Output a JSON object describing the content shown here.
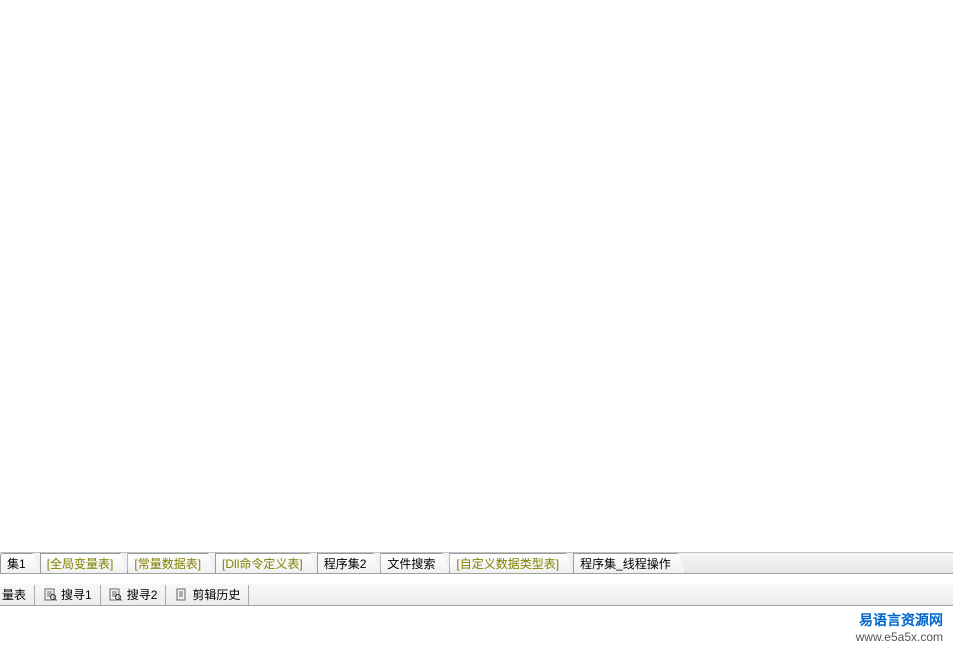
{
  "tabs": [
    {
      "label": "集1",
      "highlighted": false
    },
    {
      "label": "[全局变量表]",
      "highlighted": true
    },
    {
      "label": "[常量数据表]",
      "highlighted": true
    },
    {
      "label": "[Dll命令定义表]",
      "highlighted": true
    },
    {
      "label": "程序集2",
      "highlighted": false
    },
    {
      "label": "文件搜索",
      "highlighted": false
    },
    {
      "label": "[自定义数据类型表]",
      "highlighted": true
    },
    {
      "label": "程序集_线程操作",
      "highlighted": false
    }
  ],
  "bottomTabs": {
    "tab0": "量表",
    "tab1": "搜寻1",
    "tab2": "搜寻2",
    "tab3": "剪辑历史"
  },
  "footer": {
    "title": "易语言资源网",
    "url": "www.e5a5x.com"
  }
}
